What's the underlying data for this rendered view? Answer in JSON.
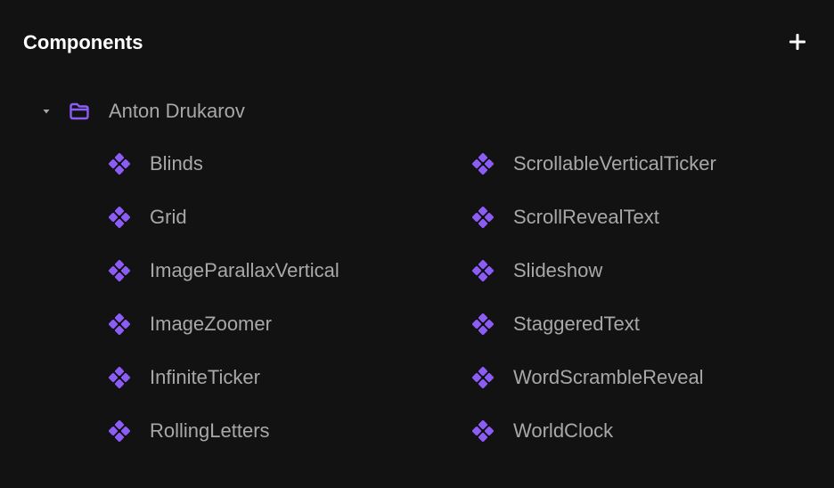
{
  "panel": {
    "title": "Components",
    "add_icon": "plus-icon"
  },
  "folder": {
    "name": "Anton Drukarov",
    "expanded": true,
    "caret_icon": "caret-down-icon",
    "icon": "folder-icon"
  },
  "components": {
    "icon": "component-icon",
    "left_column": [
      "Blinds",
      "Grid",
      "ImageParallaxVertical",
      "ImageZoomer",
      "InfiniteTicker",
      "RollingLetters"
    ],
    "right_column": [
      "ScrollableVerticalTicker",
      "ScrollRevealText",
      "Slideshow",
      "StaggeredText",
      "WordScrambleReveal",
      "WorldClock"
    ]
  },
  "colors": {
    "background": "#121212",
    "title": "#ffffff",
    "text": "#a8a8a8",
    "accent": "#8b5cf6"
  }
}
